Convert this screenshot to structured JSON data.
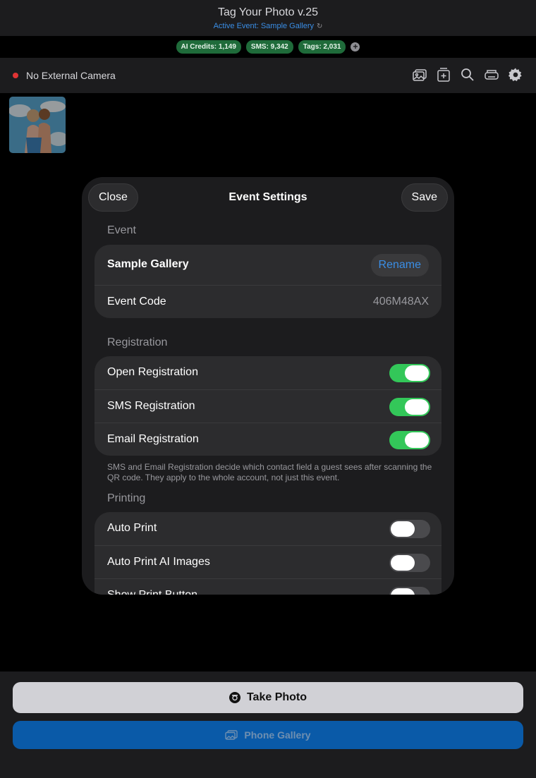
{
  "app": {
    "title": "Tag Your Photo v.25",
    "active_event": "Active Event: Sample Gallery",
    "refresh_icon": "↻"
  },
  "credits": {
    "ai": "AI Credits: 1,149",
    "sms": "SMS: 9,342",
    "tags": "Tags: 2,031",
    "add_icon": "+"
  },
  "toolbar": {
    "camera_status": "No External Camera",
    "icons": [
      "gallery-icon",
      "add-photo-icon",
      "search-icon",
      "printer-icon",
      "gear-icon"
    ]
  },
  "modal": {
    "title": "Event Settings",
    "close_label": "Close",
    "save_label": "Save",
    "event_section": {
      "label": "Event",
      "event_name": "Sample Gallery",
      "rename_label": "Rename",
      "code_label": "Event Code",
      "code_value": "406M48AX"
    },
    "registration_section": {
      "label": "Registration",
      "items": [
        {
          "label": "Open Registration",
          "on": true
        },
        {
          "label": "SMS Registration",
          "on": true
        },
        {
          "label": "Email Registration",
          "on": true
        }
      ],
      "note": "SMS and Email Registration decide which contact field a guest sees after scanning the QR code. They apply to the whole account, not just this event."
    },
    "printing_section": {
      "label": "Printing",
      "items": [
        {
          "label": "Auto Print",
          "on": false
        },
        {
          "label": "Auto Print AI Images",
          "on": false
        },
        {
          "label": "Show Print Button",
          "on": false
        }
      ]
    }
  },
  "bottom": {
    "take_photo_label": "Take Photo",
    "phone_gallery_label": "Phone Gallery"
  },
  "colors": {
    "accent_blue": "#3a8ee6",
    "toggle_on": "#33c759",
    "credit_pill": "#1f6b3a",
    "gallery_button": "#0a5aa8"
  }
}
